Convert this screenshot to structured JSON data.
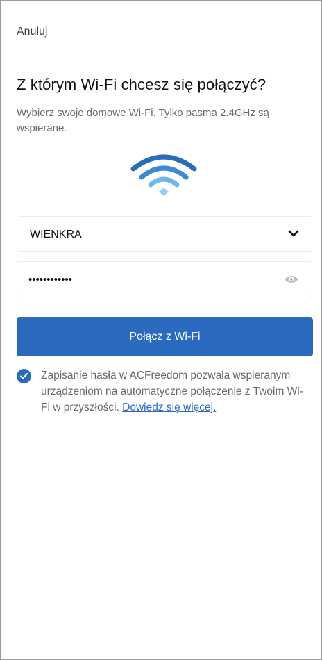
{
  "header": {
    "cancel_label": "Anuluj"
  },
  "main": {
    "title": "Z którym Wi-Fi chcesz się połączyć?",
    "subtitle": "Wybierz swoje domowe Wi-Fi. Tylko pasma 2.4GHz są wspierane.",
    "wifi_icon": "wifi-icon",
    "ssid": {
      "selected": "WIENKRA",
      "icon": "chevron-down-icon"
    },
    "password": {
      "value": "wienkra12345",
      "icon": "eye-icon"
    },
    "connect_label": "Połącz z Wi-Fi",
    "save_password": {
      "checked": true,
      "text": "Zapisanie hasła w ACFreedom pozwala wspieranym urządzeniom na automatyczne połączenie z Twoim Wi-Fi w przyszłości.",
      "link_label": "Dowiedz się więcej."
    }
  },
  "colors": {
    "accent": "#2b6bbf",
    "wifi_dark": "#2a6db7",
    "wifi_light": "#6fb6ea",
    "muted_text": "#6a6a6a"
  }
}
